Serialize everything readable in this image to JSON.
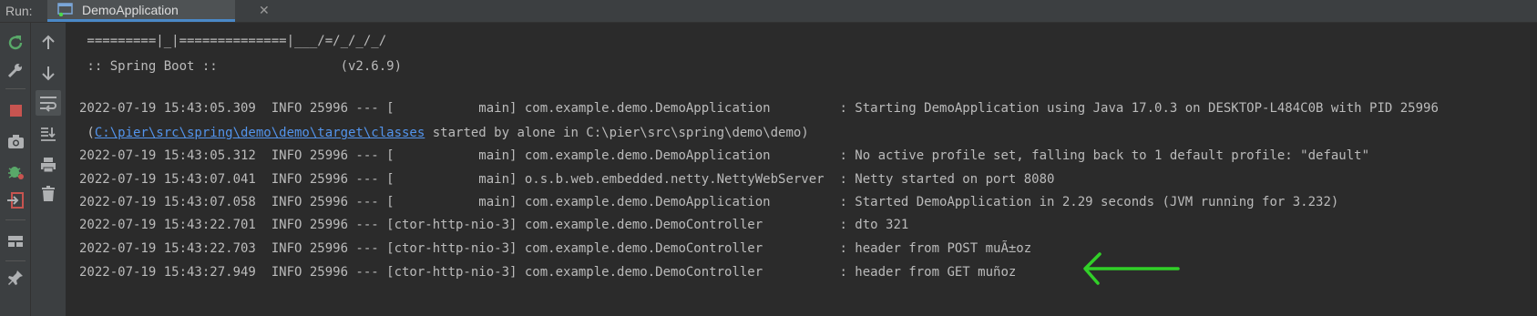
{
  "header": {
    "run_label": "Run:",
    "tab_title": "DemoApplication"
  },
  "toolbar": {
    "left_icons": [
      "rerun-icon",
      "wrench-icon",
      "stop-icon",
      "camera-icon",
      "debug-icon",
      "exit-icon",
      "layout-icon",
      "pin-icon"
    ],
    "right_icons": [
      "up-arrow-icon",
      "down-arrow-icon",
      "soft-wrap-icon",
      "scroll-to-end-icon",
      "print-icon",
      "trash-icon"
    ]
  },
  "colors": {
    "background": "#2b2b2b",
    "panel": "#3c3f41",
    "text": "#bbbbbb",
    "link": "#5394ec",
    "annotation_arrow": "#31d028"
  },
  "console": {
    "banner_line": " =========|_|==============|___/=/_/_/_/",
    "spring_line": " :: Spring Boot ::                (v2.6.9)",
    "line1": "2022-07-19 15:43:05.309  INFO 25996 --- [           main] com.example.demo.DemoApplication         : Starting DemoApplication using Java 17.0.3 on DESKTOP-L484C0B with PID 25996",
    "line2_prefix": " (",
    "line2_link": "C:\\pier\\src\\spring\\demo\\demo\\target\\classes",
    "line2_suffix": " started by alone in C:\\pier\\src\\spring\\demo\\demo)",
    "line3": "2022-07-19 15:43:05.312  INFO 25996 --- [           main] com.example.demo.DemoApplication         : No active profile set, falling back to 1 default profile: \"default\"",
    "line4": "2022-07-19 15:43:07.041  INFO 25996 --- [           main] o.s.b.web.embedded.netty.NettyWebServer  : Netty started on port 8080",
    "line5": "2022-07-19 15:43:07.058  INFO 25996 --- [           main] com.example.demo.DemoApplication         : Started DemoApplication in 2.29 seconds (JVM running for 3.232)",
    "line6": "2022-07-19 15:43:22.701  INFO 25996 --- [ctor-http-nio-3] com.example.demo.DemoController          : dto 321",
    "line7": "2022-07-19 15:43:22.703  INFO 25996 --- [ctor-http-nio-3] com.example.demo.DemoController          : header from POST muÃ±oz",
    "line8": "2022-07-19 15:43:27.949  INFO 25996 --- [ctor-http-nio-3] com.example.demo.DemoController          : header from GET muñoz"
  }
}
